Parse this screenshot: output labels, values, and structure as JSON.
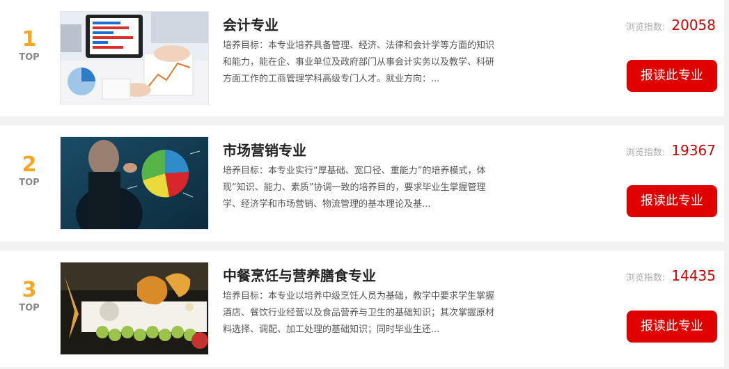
{
  "majors": [
    {
      "rank": "1",
      "top": "TOP",
      "title": "会计专业",
      "desc": "培养目标：本专业培养具备管理、经济、法律和会计学等方面的知识和能力，能在企、事业单位及政府部门从事会计实务以及教学、科研方面工作的工商管理学科高级专门人才。就业方向：...",
      "views_label": "浏览指数:",
      "views": "20058",
      "button": "报读此专业",
      "image": "accounting-charts-photo"
    },
    {
      "rank": "2",
      "top": "TOP",
      "title": "市场营销专业",
      "desc": "培养目标：本专业实行“厚基础、宽口径、重能力”的培养模式，体现“知识、能力、素质”协调一致的培养目的，要求毕业生掌握管理学、经济学和市场营销、物流管理的基本理论及基...",
      "views_label": "浏览指数:",
      "views": "19367",
      "button": "报读此专业",
      "image": "marketing-pie-chart-photo"
    },
    {
      "rank": "3",
      "top": "TOP",
      "title": "中餐烹饪与营养膳食专业",
      "desc": "培养目标：本专业以培养中级烹饪人员为基础，教学中要求学生掌握酒店、餐饮行业经营以及食品营养与卫生的基础知识；其次掌握原材料选择、调配、加工处理的基础知识；同时毕业生还...",
      "views_label": "浏览指数:",
      "views": "14435",
      "button": "报读此专业",
      "image": "food-carving-photo"
    }
  ]
}
